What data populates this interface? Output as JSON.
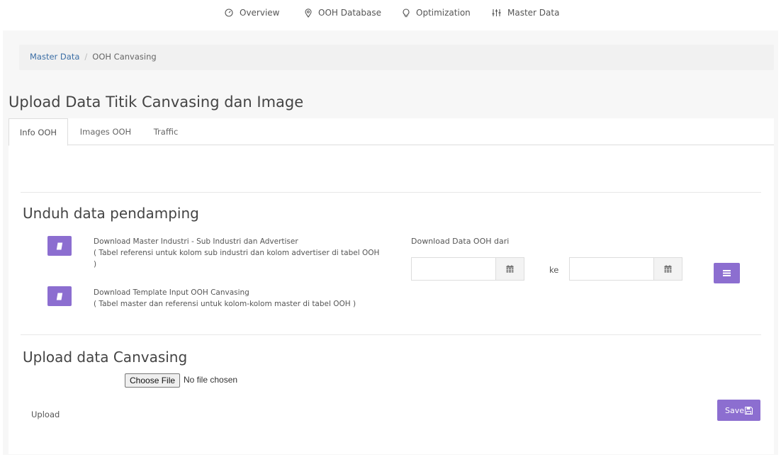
{
  "nav": {
    "items": [
      {
        "label": "Overview",
        "icon": "gauge-icon"
      },
      {
        "label": "OOH Database",
        "icon": "map-pin-icon"
      },
      {
        "label": "Optimization",
        "icon": "lightbulb-icon"
      },
      {
        "label": "Master Data",
        "icon": "sliders-icon"
      }
    ]
  },
  "breadcrumb": {
    "parent": "Master Data",
    "separator": "/",
    "current": "OOH Canvasing"
  },
  "page": {
    "title": "Upload Data Titik Canvasing dan Image"
  },
  "tabs": [
    {
      "label": "Info OOH",
      "active": true
    },
    {
      "label": "Images OOH",
      "active": false
    },
    {
      "label": "Traffic",
      "active": false
    }
  ],
  "download_section": {
    "title": "Unduh data pendamping",
    "items": [
      {
        "title": "Download Master Industri - Sub Industri dan Advertiser",
        "description": "( Tabel referensi untuk kolom sub industri dan kolom advertiser di tabel OOH )"
      },
      {
        "title": "Download Template Input OOH Canvasing",
        "description": "( Tabel master dan referensi untuk kolom-kolom master di tabel OOH )"
      }
    ],
    "date_range_label": "Download Data OOH dari",
    "from_value": "",
    "to_label": "ke",
    "to_value": ""
  },
  "upload_section": {
    "title": "Upload data Canvasing",
    "field_label": "Upload",
    "choose_file_label": "Choose File",
    "file_status": "No file chosen",
    "save_label": "Save"
  },
  "colors": {
    "accent": "#8c6ed0",
    "link": "#3b6ea5",
    "page_bg": "#f7f7f7"
  }
}
